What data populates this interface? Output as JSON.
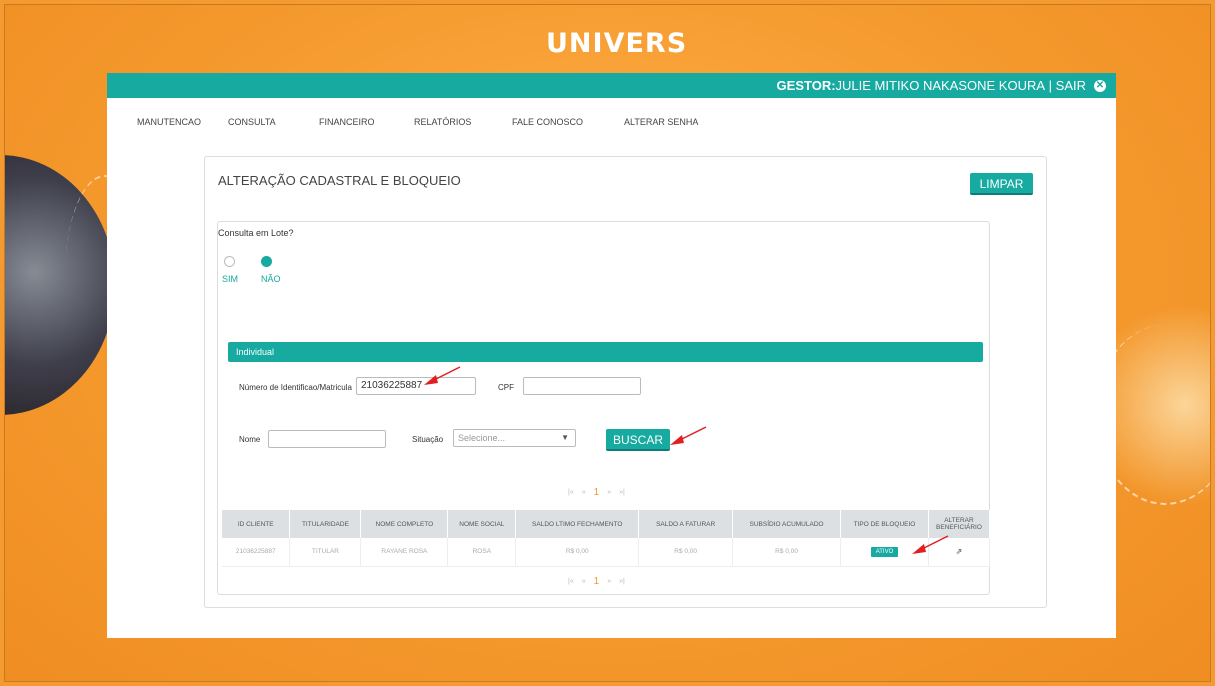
{
  "brand": {
    "logo": "UNIVERS",
    "accent": "#16aaa0",
    "background": "#f49a30"
  },
  "topbar": {
    "role": "GESTOR:",
    "user": "JULIE MITIKO NAKASONE KOURA",
    "separator": " | ",
    "logout": "SAIR"
  },
  "menu": [
    {
      "label": "MANUTENCAO"
    },
    {
      "label": "CONSULTA"
    },
    {
      "label": "FINANCEIRO"
    },
    {
      "label": "RELATÓRIOS"
    },
    {
      "label": "FALE CONOSCO"
    },
    {
      "label": "ALTERAR SENHA"
    }
  ],
  "card": {
    "title": "ALTERAÇÃO CADASTRAL E BLOQUEIO",
    "clear_label": "LIMPAR"
  },
  "lote": {
    "question": "Consulta em Lote?",
    "yes": "SIM",
    "no": "NÃO",
    "selected": "NÃO"
  },
  "individual": {
    "section_title": "Individual",
    "id_label": "Número de Identificao/Matricula",
    "id_value": "21036225887",
    "cpf_label": "CPF",
    "cpf_value": "",
    "name_label": "Nome",
    "name_value": "",
    "status_label": "Situação",
    "status_placeholder": "Selecione...",
    "search_label": "BUSCAR"
  },
  "pager": {
    "first": "|«",
    "prev": "«",
    "current": "1",
    "next": "»",
    "last": "»|"
  },
  "table": {
    "headers": [
      "ID CLIENTE",
      "TITULARIDADE",
      "NOME COMPLETO",
      "NOME SOCIAL",
      "SALDO LTIMO FECHAMENTO",
      "SALDO A FATURAR",
      "SUBSÍDIO ACUMULADO",
      "TIPO DE BLOQUEIO",
      "ALTERAR BENEFICIÁRIO"
    ],
    "rows": [
      {
        "id": "21036225887",
        "titularidade": "TITULAR",
        "nome": "RAYANE ROSA",
        "social": "ROSA",
        "saldo_fechamento": "R$ 0,00",
        "saldo_faturar": "R$ 0,00",
        "subsidio": "R$ 0,00",
        "bloqueio": "ATIVO"
      }
    ]
  }
}
